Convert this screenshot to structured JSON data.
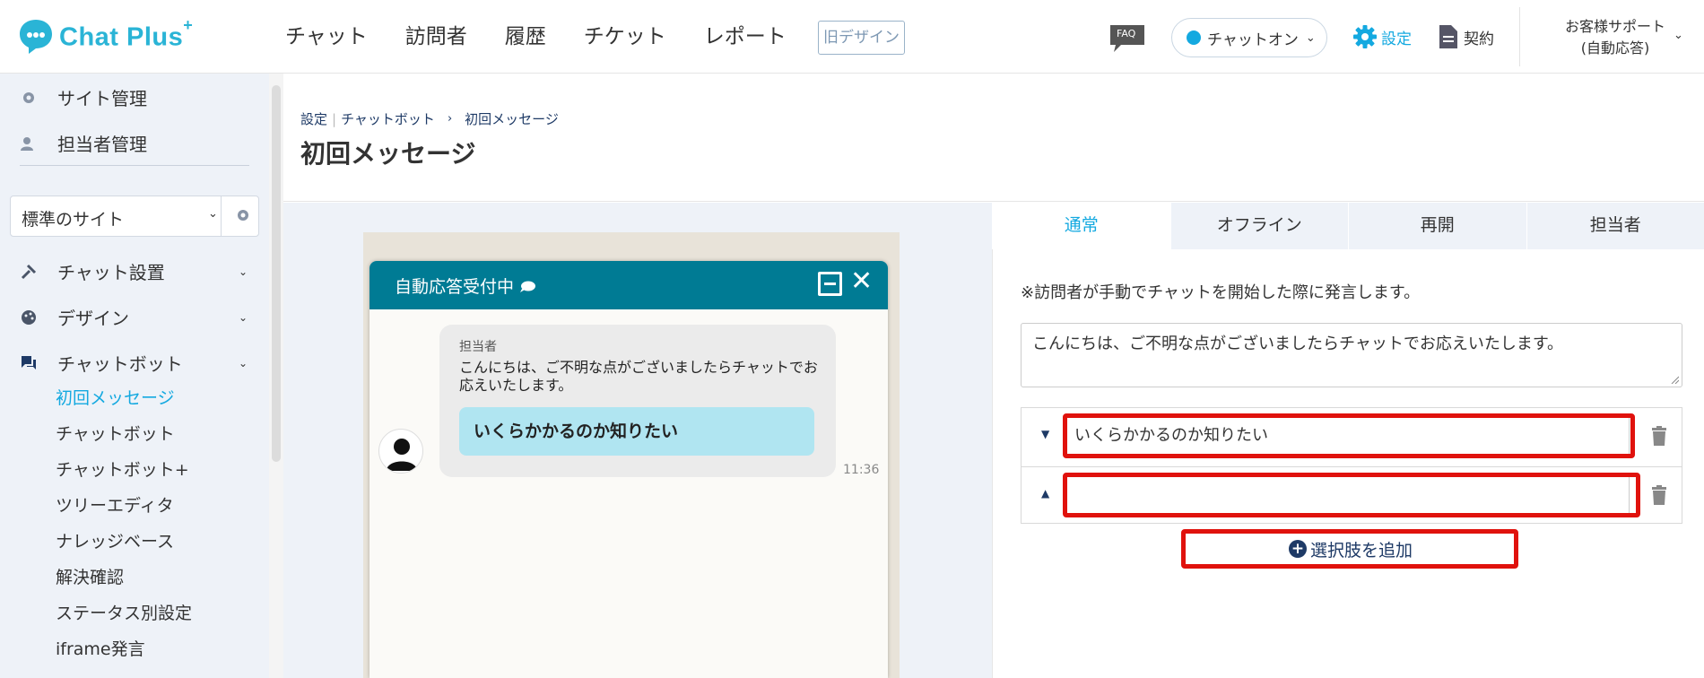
{
  "header": {
    "logo_text": "Chat Plus",
    "logo_sup": "+",
    "nav": [
      "チャット",
      "訪問者",
      "履歴",
      "チケット",
      "レポート"
    ],
    "old_design": "旧デザイン",
    "faq": "FAQ",
    "chat_status": "チャットオン",
    "settings": "設定",
    "contract": "契約",
    "support_line1": "お客様サポート",
    "support_line2": "(自動応答)"
  },
  "sidebar": {
    "top_items": [
      "サイト管理",
      "担当者管理"
    ],
    "site_select": "標準のサイト",
    "sections": [
      "チャット設置",
      "デザイン",
      "チャットボット"
    ],
    "sub_items": [
      "初回メッセージ",
      "チャットボット",
      "チャットボット+",
      "ツリーエディタ",
      "ナレッジベース",
      "解決確認",
      "ステータス別設定",
      "iframe発言"
    ]
  },
  "breadcrumb": {
    "settings": "設定",
    "chatbot": "チャットボット",
    "current": "初回メッセージ"
  },
  "page_title": "初回メッセージ",
  "preview": {
    "widget_title": "自動応答受付中",
    "sender": "担当者",
    "message": "こんにちは、ご不明な点がございましたらチャットでお応えいたします。",
    "choice": "いくらかかるのか知りたい",
    "time": "11:36"
  },
  "tabs": [
    "通常",
    "オフライン",
    "再開",
    "担当者"
  ],
  "form": {
    "note": "※訪問者が手動でチャットを開始した際に発言します。",
    "message_value": "こんにちは、ご不明な点がございましたらチャットでお応えいたします。",
    "choices": [
      "いくらかかるのか知りたい",
      ""
    ],
    "add_choice": "選択肢を追加"
  },
  "colors": {
    "accent": "#14a9e0",
    "widget_header": "#007b94",
    "choice_bg": "#b0e5f1",
    "highlight": "#e0120d",
    "sidebar_bg": "#eef2f8"
  }
}
